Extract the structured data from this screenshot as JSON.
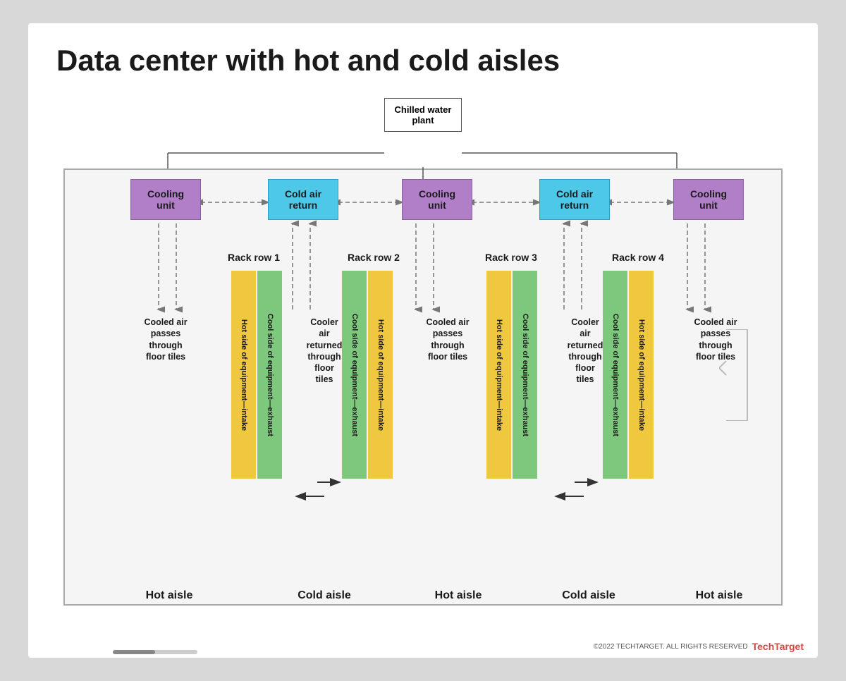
{
  "title": "Data center with hot and cold aisles",
  "chilled_water_plant": "Chilled water\nplant",
  "cooling_units": [
    "Cooling unit",
    "Cooling unit",
    "Cooling unit"
  ],
  "cold_air_returns": [
    "Cold air\nreturn",
    "Cold air\nreturn"
  ],
  "rack_rows": [
    "Rack row 1",
    "Rack row 2",
    "Rack row 3",
    "Rack row 4"
  ],
  "rack_labels": {
    "hot_side": "Hot side of equipment—intake",
    "cool_side": "Cool side of equipment—exhaust",
    "cool_side_b": "Cool side of equipment—exhaust",
    "hot_side_b": "Hot side of equipment—intake"
  },
  "aisles": {
    "hot1": "Hot aisle",
    "cold1": "Cold aisle",
    "hot2": "Hot aisle",
    "cold2": "Cold aisle",
    "hot3": "Hot aisle"
  },
  "flow_texts": {
    "cooled1": "Cooled air\npasses\nthrough\nfloor tiles",
    "cooler1": "Cooler\nair\nreturned\nthrough\nfloor\ntiles",
    "cooled2": "Cooled air\npasses\nthrough\nfloor tiles",
    "cooler2": "Cooler\nair\nreturned\nthrough\nfloor\ntiles",
    "cooled3": "Cooled air\npasses\nthrough\nfloor tiles"
  },
  "footer": {
    "copyright": "©2022 TECHTARGET. ALL RIGHTS RESERVED",
    "brand": "TechTarget"
  }
}
